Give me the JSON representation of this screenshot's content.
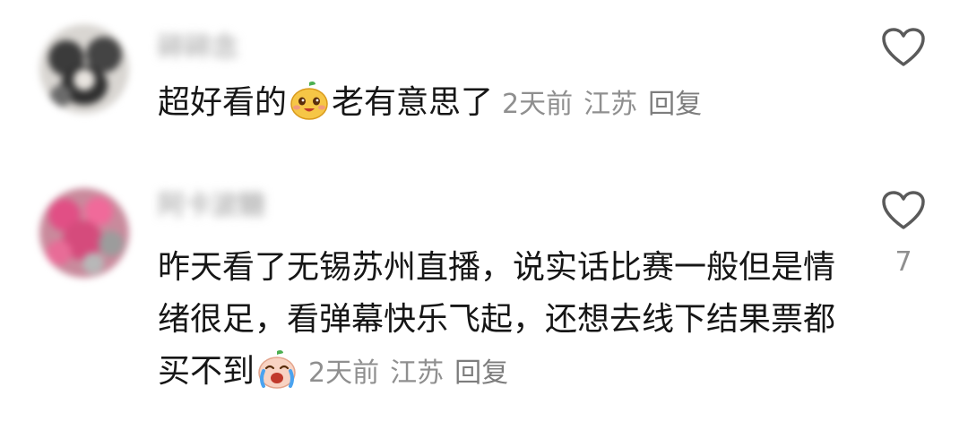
{
  "comments": [
    {
      "username": "碎碎念",
      "text_before_emoji": "超好看的",
      "emoji": "smiling-pear-emoji",
      "text_after_emoji": "老有意思了",
      "time": "2天前",
      "location": "江苏",
      "reply_label": "回复",
      "like_count": ""
    },
    {
      "username": "阿卡波糖",
      "text_before_emoji": "昨天看了无锡苏州直播，说实话比赛一般但是情绪很足，看弹幕快乐飞起，还想去线下结果票都买不到",
      "emoji": "crying-pear-emoji",
      "text_after_emoji": "",
      "time": "2天前",
      "location": "江苏",
      "reply_label": "回复",
      "like_count": "7"
    }
  ],
  "icons": {
    "like": "heart-outline-icon"
  },
  "colors": {
    "text": "#161616",
    "meta": "#8f8f8f",
    "heart_stroke": "#5a5a5a",
    "background": "#ffffff"
  }
}
